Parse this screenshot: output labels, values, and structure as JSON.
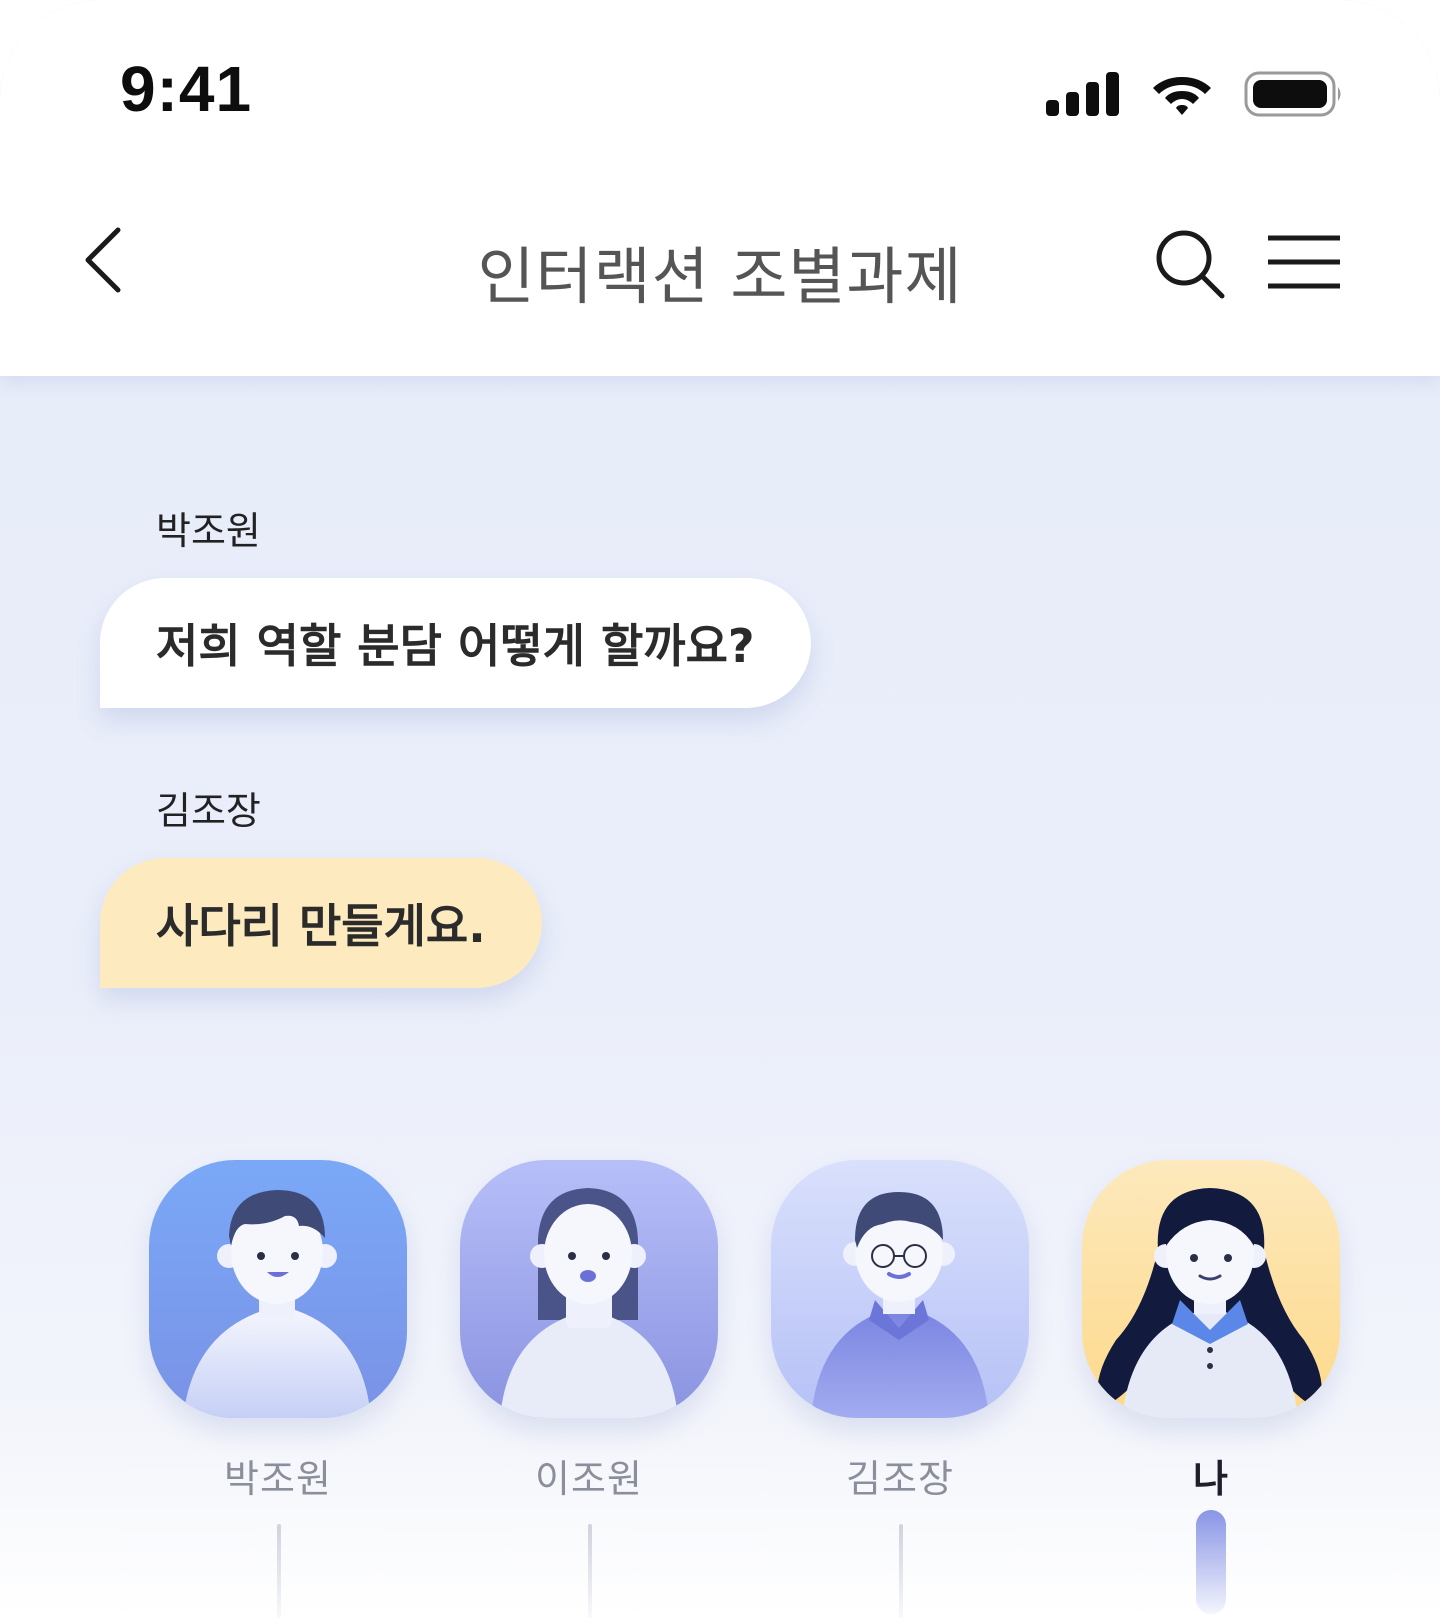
{
  "status_bar": {
    "time": "9:41"
  },
  "header": {
    "title": "인터랙션 조별과제"
  },
  "messages": [
    {
      "sender": "박조원",
      "text": "저희 역할 분담 어떻게 할까요?",
      "style": "white"
    },
    {
      "sender": "김조장",
      "text": "사다리 만들게요.",
      "style": "yellow"
    }
  ],
  "members": [
    {
      "name": "박조원",
      "selected": false
    },
    {
      "name": "이조원",
      "selected": false
    },
    {
      "name": "김조장",
      "selected": false
    },
    {
      "name": "나",
      "selected": true
    }
  ],
  "colors": {
    "bubble_white": "#ffffff",
    "bubble_yellow": "#fdebbf",
    "background": "#e7ecfa",
    "accent": "#8a95e6"
  },
  "icons": [
    "cellular-signal-icon",
    "wifi-icon",
    "battery-icon",
    "back-chevron-icon",
    "search-icon",
    "menu-icon"
  ]
}
